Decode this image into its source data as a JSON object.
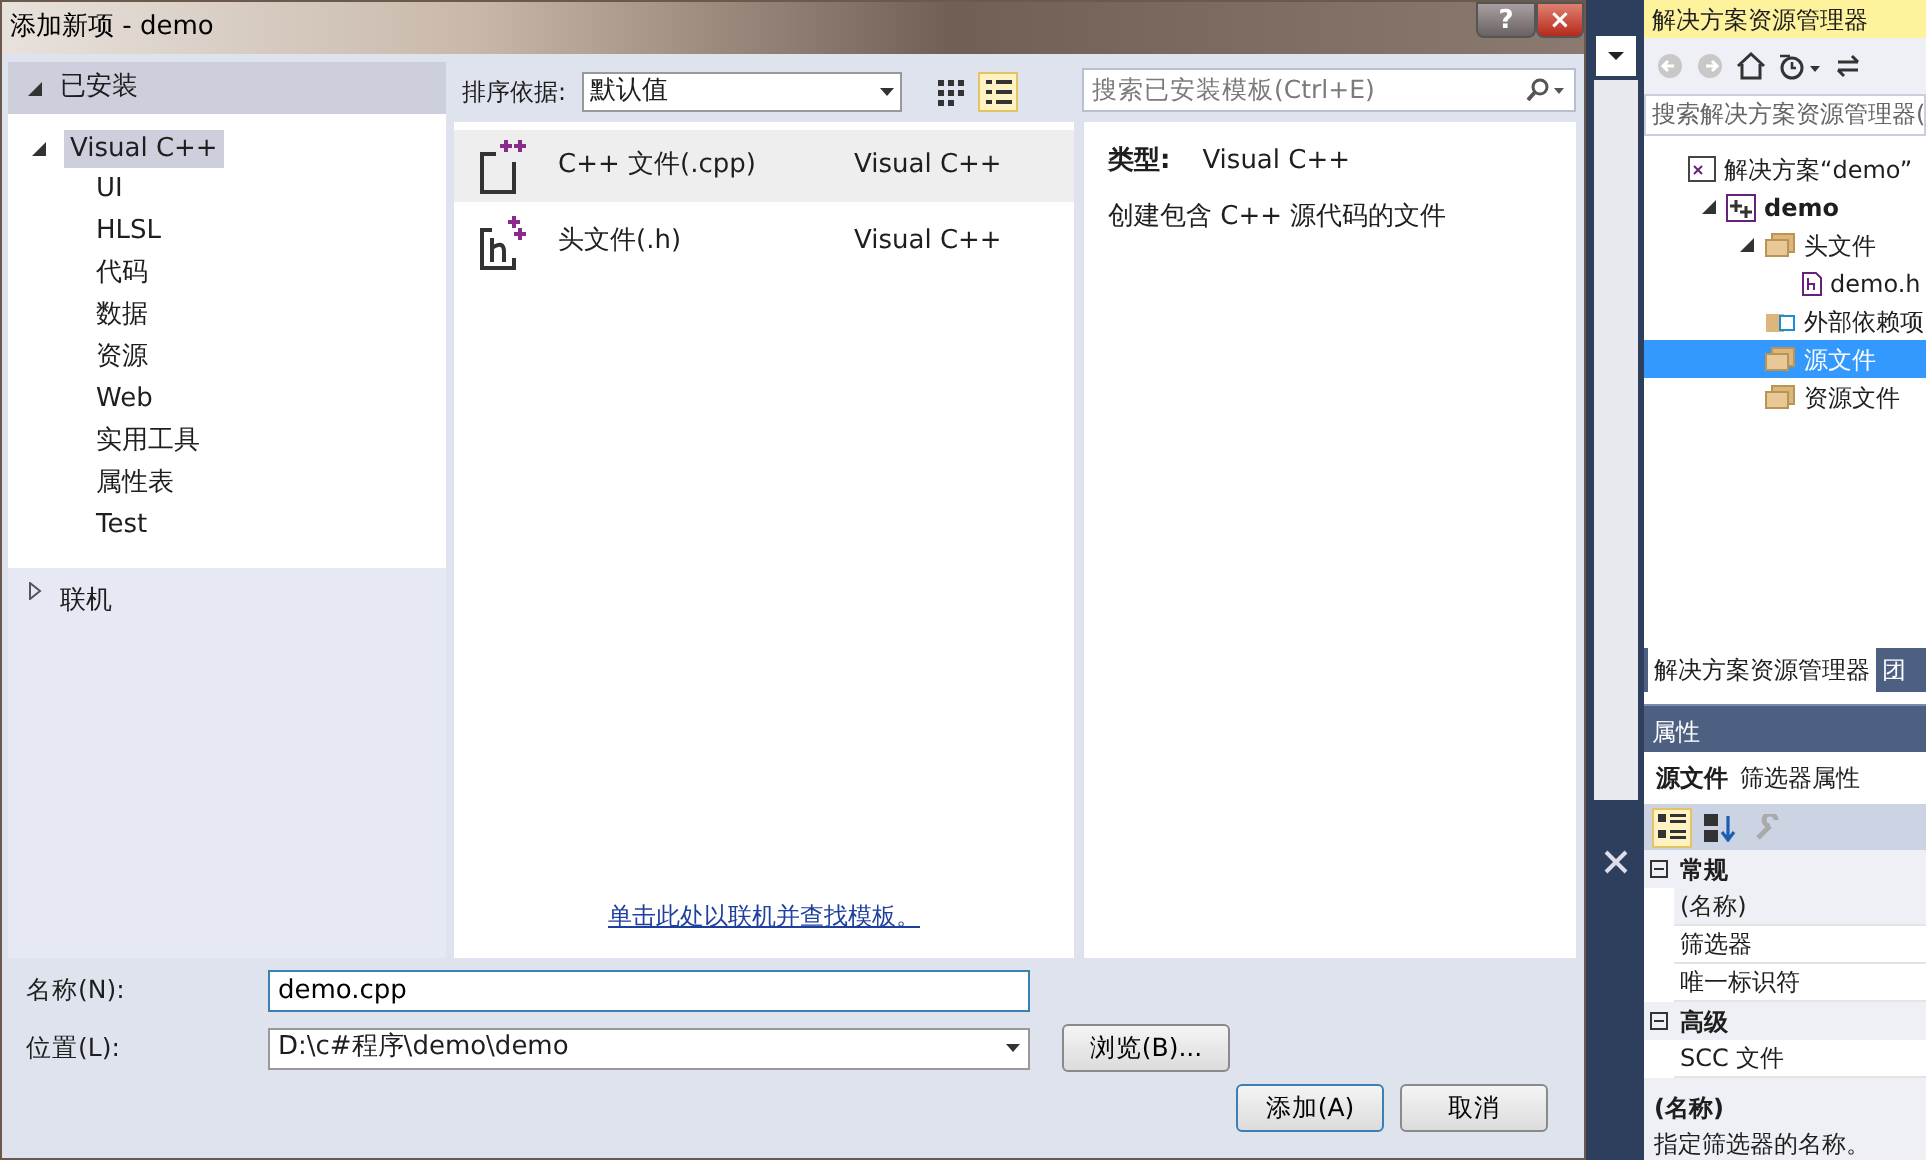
{
  "window": {
    "title": "添加新项 - demo",
    "help_glyph": "?",
    "close_glyph": "×"
  },
  "categories": {
    "installed": {
      "label": "已安装",
      "expanded": true
    },
    "tree": [
      {
        "label": "Visual C++",
        "selected": true,
        "expanded": true,
        "children": [
          {
            "label": "UI",
            "selected": false
          },
          {
            "label": "HLSL",
            "selected": false
          },
          {
            "label": "代码",
            "selected": false
          },
          {
            "label": "数据",
            "selected": false
          },
          {
            "label": "资源",
            "selected": false
          },
          {
            "label": "Web",
            "selected": false
          },
          {
            "label": "实用工具",
            "selected": false
          },
          {
            "label": "属性表",
            "selected": false
          },
          {
            "label": "Test",
            "selected": false
          }
        ]
      }
    ],
    "online": {
      "label": "联机",
      "expanded": false
    }
  },
  "toolbar": {
    "sort_label": "排序依据:",
    "sort_value": "默认值",
    "views": [
      {
        "kind": "grid",
        "selected": false
      },
      {
        "kind": "list",
        "selected": true
      }
    ]
  },
  "search": {
    "placeholder": "搜索已安装模板(Ctrl+E)"
  },
  "templates": [
    {
      "kind": "cpp",
      "name": "C++ 文件(.cpp)",
      "language": "Visual C++",
      "selected": true
    },
    {
      "kind": "header",
      "name": "头文件(.h)",
      "language": "Visual C++",
      "selected": false
    }
  ],
  "online_link": "单击此处以联机并查找模板。",
  "details": {
    "type_label": "类型:",
    "type_value": "Visual C++",
    "description": "创建包含 C++ 源代码的文件"
  },
  "form": {
    "name_label": "名称(N):",
    "name_value": "demo.cpp",
    "location_label": "位置(L):",
    "location_value": "D:\\c#程序\\demo\\demo",
    "browse": "浏览(B)...",
    "add": "添加(A)",
    "cancel": "取消"
  },
  "solution_explorer": {
    "title": "解决方案资源管理器",
    "search_placeholder": "搜索解决方案资源管理器(",
    "tree": [
      {
        "kind": "solution",
        "label": "解决方案“demo”",
        "selected": false,
        "children": [
          {
            "kind": "project",
            "label": "demo",
            "selected": false,
            "expanded": true,
            "children": [
              {
                "kind": "filter",
                "label": "头文件",
                "selected": false,
                "expanded": true,
                "children": [
                  {
                    "kind": "file",
                    "label": "demo.h",
                    "selected": false
                  }
                ]
              },
              {
                "kind": "deps",
                "label": "外部依赖项",
                "selected": false
              },
              {
                "kind": "filter",
                "label": "源文件",
                "selected": true
              },
              {
                "kind": "filter",
                "label": "资源文件",
                "selected": false
              }
            ]
          }
        ]
      }
    ],
    "tabs": [
      {
        "label": "解决方案资源管理器",
        "selected": true
      },
      {
        "label": "团",
        "selected": false
      }
    ]
  },
  "properties": {
    "title": "属性",
    "subject_name": "源文件",
    "subject_type": "筛选器属性",
    "tools": [
      {
        "kind": "categorized",
        "selected": true,
        "disabled": false
      },
      {
        "kind": "alphabetical",
        "selected": false,
        "disabled": false
      },
      {
        "kind": "wrench",
        "selected": false,
        "disabled": true
      }
    ],
    "groups": [
      {
        "name": "常规",
        "expanded": true,
        "rows": [
          {
            "name": "(名称)",
            "selected": true
          },
          {
            "name": "筛选器",
            "selected": false
          },
          {
            "name": "唯一标识符",
            "selected": false
          }
        ]
      },
      {
        "name": "高级",
        "expanded": true,
        "rows": [
          {
            "name": "SCC 文件",
            "selected": false
          }
        ]
      }
    ],
    "description_title": "(名称)",
    "description": "指定筛选器的名称。"
  }
}
